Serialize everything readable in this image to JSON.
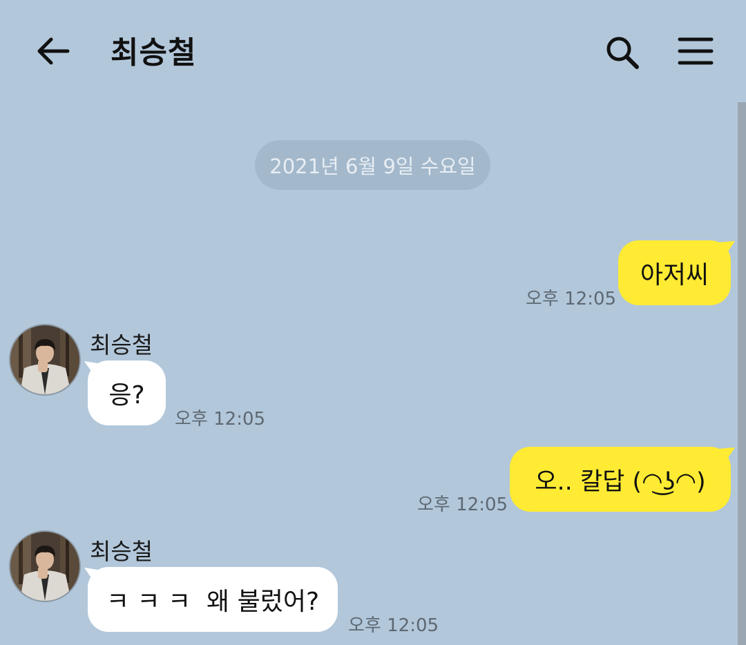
{
  "header": {
    "title": "최승철"
  },
  "date_divider": "2021년 6월 9일 수요일",
  "messages": [
    {
      "side": "me",
      "text": "아저씨",
      "time": "오후 12:05"
    },
    {
      "side": "other",
      "sender": "최승철",
      "text": "응?",
      "time": "오후 12:05"
    },
    {
      "side": "me",
      "text": "오.. 칼답 (◠͜ʖ◠)",
      "time": "오후 12:05"
    },
    {
      "side": "other",
      "sender": "최승철",
      "text": "ㅋ ㅋ ㅋ  왜 불렀어?",
      "time": "오후 12:05"
    }
  ],
  "colors": {
    "background": "#b2c7da",
    "my_bubble": "#ffeb33",
    "their_bubble": "#ffffff"
  },
  "icons": [
    "back-arrow-icon",
    "search-icon",
    "menu-icon"
  ]
}
